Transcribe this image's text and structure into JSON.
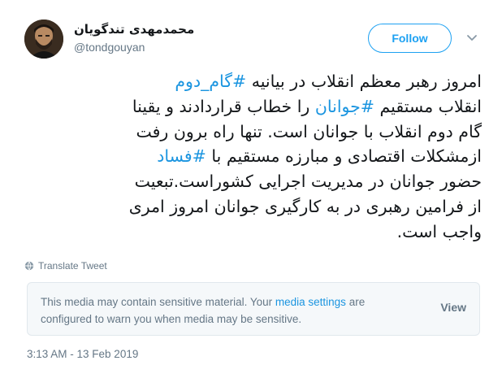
{
  "user": {
    "display_name": "محمدمهدی تندگویان",
    "handle": "@tondgouyan"
  },
  "follow_button": {
    "label": "Follow"
  },
  "tweet": {
    "lines": [
      [
        {
          "text": "امروز رهبر معظم انقلاب در بیانیه ",
          "hashtag": false
        },
        {
          "text": "#گام_دوم",
          "hashtag": true
        }
      ],
      [
        {
          "text": "انقلاب مستقیم ",
          "hashtag": false
        },
        {
          "text": "#جوانان",
          "hashtag": true
        },
        {
          "text": " را خطاب قراردادند و یقینا",
          "hashtag": false
        }
      ],
      [
        {
          "text": "گام دوم انقلاب با جوانان است. تنها راه برون رفت",
          "hashtag": false
        }
      ],
      [
        {
          "text": "ازمشکلات اقتصادی و مبارزه مستقیم با ",
          "hashtag": false
        },
        {
          "text": "#فساد",
          "hashtag": true
        }
      ],
      [
        {
          "text": "حضور جوانان در مدیریت اجرایی کشوراست.تبعیت",
          "hashtag": false
        }
      ],
      [
        {
          "text": "از فرامین رهبری در به کارگیری جوانان امروز امری",
          "hashtag": false
        }
      ],
      [
        {
          "text": "واجب است.",
          "hashtag": false
        }
      ]
    ]
  },
  "translate": {
    "label": "Translate Tweet",
    "icon": "globe-icon"
  },
  "sensitive_notice": {
    "text_before": "This media may contain sensitive material. Your ",
    "link_text": "media settings",
    "text_after": " are configured to warn you when media may be sensitive.",
    "view_label": "View"
  },
  "timestamp": "3:13 AM - 13 Feb 2019",
  "colors": {
    "accent": "#1da1f2",
    "hashtag": "#1b95e0",
    "muted": "#657786",
    "text": "#14171a",
    "notice_bg": "#f5f8fa",
    "border": "#e1e8ed"
  }
}
